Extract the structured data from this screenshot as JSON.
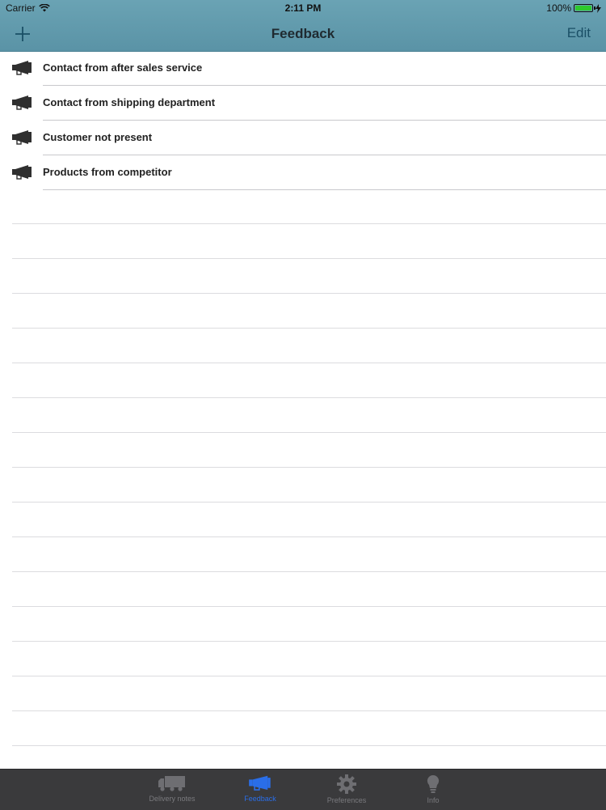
{
  "status_bar": {
    "carrier": "Carrier",
    "time": "2:11 PM",
    "battery": "100%"
  },
  "nav": {
    "title": "Feedback",
    "edit_label": "Edit"
  },
  "feedback_items": [
    {
      "label": "Contact from after sales service"
    },
    {
      "label": "Contact from shipping department"
    },
    {
      "label": "Customer not present"
    },
    {
      "label": "Products from competitor"
    }
  ],
  "tabs": [
    {
      "label": "Delivery notes",
      "icon": "truck-icon",
      "active": false
    },
    {
      "label": "Feedback",
      "icon": "megaphone-icon",
      "active": true
    },
    {
      "label": "Preferences",
      "icon": "gear-icon",
      "active": false
    },
    {
      "label": "Info",
      "icon": "lightbulb-icon",
      "active": false
    }
  ],
  "colors": {
    "header": "#5f99ac",
    "active_tab": "#2a6ee8",
    "tab_bar": "#3a3a3c",
    "battery": "#2ec92e"
  }
}
